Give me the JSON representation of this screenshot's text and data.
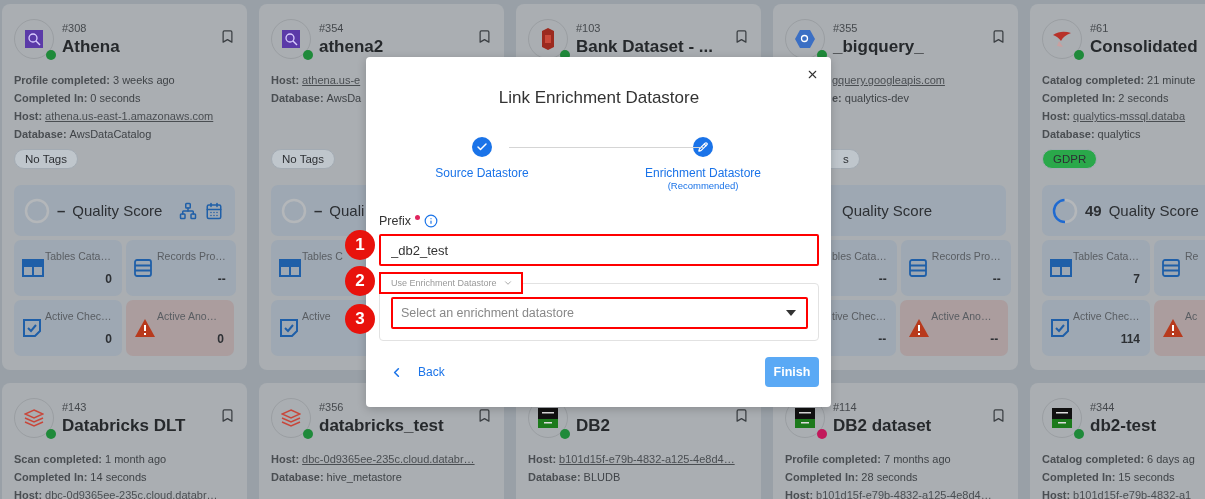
{
  "top_row": [
    {
      "number": "#308",
      "name": "Athena",
      "logo": {
        "kind": "athena"
      },
      "status": {
        "color": "#1f8a3a"
      },
      "details": [
        {
          "label": "Profile completed:",
          "value": "3 weeks ago"
        },
        {
          "label": "Completed In:",
          "value": "0 seconds"
        },
        {
          "label": "Host:",
          "value": "athena.us-east-1.amazonaws.com",
          "link": true
        },
        {
          "label": "Database:",
          "value": "AwsDataCatalog"
        }
      ],
      "tags": [
        {
          "label": "No Tags",
          "color": "#bfc6cc"
        }
      ],
      "quality": {
        "score": "–",
        "label": "Quality Score",
        "tools": true
      },
      "metrics": [
        [
          {
            "kind": "tables",
            "label": "Tables Cata…",
            "value": "0"
          },
          {
            "kind": "records",
            "label": "Records Pro…",
            "value": "--"
          }
        ],
        [
          {
            "kind": "checks",
            "label": "Active Chec…",
            "value": "0"
          },
          {
            "kind": "anomalies",
            "label": "Active Ano…",
            "value": "0"
          }
        ]
      ]
    },
    {
      "number": "#354",
      "name": "athena2",
      "logo": {
        "kind": "athena"
      },
      "status": {
        "color": "#1f8a3a"
      },
      "details": [
        {
          "label": "Host:",
          "value": "athena.us-e",
          "link": true
        },
        {
          "label": "Database:",
          "value": "AwsDa"
        }
      ],
      "tags": [
        {
          "label": "No Tags",
          "color": "#bfc6cc"
        }
      ],
      "quality": {
        "score": "–",
        "label": "Quali"
      },
      "metrics": [
        [
          {
            "kind": "tables",
            "label": "Tables C"
          }
        ],
        [
          {
            "kind": "checks",
            "label": "Active"
          }
        ]
      ]
    },
    {
      "number": "#103",
      "name": "Bank Dataset - ...",
      "logo": {
        "kind": "bank"
      },
      "status": {
        "color": "#1f8a3a"
      }
    },
    {
      "number": "#355",
      "name": "_bigquery_",
      "logo": {
        "kind": "bigquery"
      },
      "status": {
        "color": "#1f8a3a"
      },
      "details": [
        {
          "value": "gquery.googleapis.com",
          "link": true
        },
        {
          "label": "e:",
          "value": "qualytics-dev"
        }
      ],
      "tags": [
        {
          "label": "s",
          "color": "#bfc6cc"
        }
      ],
      "quality": {
        "label": "Quality Score"
      },
      "metrics": [
        [
          {
            "kind": "tables",
            "label": "bles Cata…",
            "value": "--",
            "cut": true
          },
          {
            "kind": "records",
            "label": "Records Pro…",
            "value": "--"
          }
        ],
        [
          {
            "kind": "checks",
            "label": "tive Chec…",
            "value": "--",
            "cut": true
          },
          {
            "kind": "anomalies",
            "label": "Active Ano…",
            "value": "--"
          }
        ]
      ]
    },
    {
      "number": "#61",
      "name": "Consolidated",
      "logo": {
        "kind": "mssql"
      },
      "status": {
        "color": "#1f8a3a"
      },
      "details": [
        {
          "label": "Catalog completed:",
          "value": "21 minute"
        },
        {
          "label": "Completed In:",
          "value": "2 seconds"
        },
        {
          "label": "Host:",
          "value": "qualytics-mssql.databa",
          "link": true
        },
        {
          "label": "Database:",
          "value": "qualytics"
        }
      ],
      "tags": [
        {
          "label": "GDPR",
          "color": "#2aa84a"
        }
      ],
      "quality": {
        "score": "49",
        "label": "Quality Score",
        "level": 0.49
      },
      "metrics": [
        [
          {
            "kind": "tables",
            "label": "Tables Cata…",
            "value": "7"
          },
          {
            "kind": "records",
            "label": "Re"
          }
        ],
        [
          {
            "kind": "checks",
            "label": "Active Chec…",
            "value": "114"
          },
          {
            "kind": "anomalies",
            "label": "Ac"
          }
        ]
      ]
    }
  ],
  "bottom_row": [
    {
      "number": "#143",
      "name": "Databricks DLT",
      "logo": {
        "kind": "databricks"
      },
      "status": {
        "color": "#1f8a3a"
      },
      "details": [
        {
          "label": "Scan completed:",
          "value": "1 month ago"
        },
        {
          "label": "Completed In:",
          "value": "14 seconds"
        },
        {
          "label": "Host:",
          "value": "dbc-0d9365ee-235c.cloud.databr…",
          "link": true
        }
      ]
    },
    {
      "number": "#356",
      "name": "databricks_test",
      "logo": {
        "kind": "databricks"
      },
      "status": {
        "color": "#1f8a3a"
      },
      "details": [
        {
          "label": "Host:",
          "value": "dbc-0d9365ee-235c.cloud.databr…",
          "link": true
        },
        {
          "label": "Database:",
          "value": "hive_metastore"
        }
      ]
    },
    {
      "name": "DB2",
      "logo": {
        "kind": "db2"
      },
      "status": {
        "color": "#1f8a3a"
      },
      "details": [
        {
          "label": "Host:",
          "value": "b101d15f-e79b-4832-a125-4e8d4…",
          "link": true
        },
        {
          "label": "Database:",
          "value": "BLUDB"
        }
      ]
    },
    {
      "number": "#114",
      "name": "DB2 dataset",
      "logo": {
        "kind": "db2"
      },
      "status": {
        "color": "#c2185b"
      },
      "details": [
        {
          "label": "Profile completed:",
          "value": "7 months ago"
        },
        {
          "label": "Completed In:",
          "value": "28 seconds"
        },
        {
          "label": "Host:",
          "value": "b101d15f-e79b-4832-a125-4e8d4…",
          "link": true
        }
      ]
    },
    {
      "number": "#344",
      "name": "db2-test",
      "logo": {
        "kind": "db2"
      },
      "status": {
        "color": "#1f8a3a"
      },
      "details": [
        {
          "label": "Catalog completed:",
          "value": "6 days ag"
        },
        {
          "label": "Completed In:",
          "value": "15 seconds"
        },
        {
          "label": "Host:",
          "value": "b101d15f-e79b-4832-a1",
          "link": true
        }
      ]
    }
  ],
  "dialog": {
    "title": "Link Enrichment Datastore",
    "steps": [
      {
        "label": "Source Datastore",
        "kind": "done"
      },
      {
        "label": "Enrichment Datastore",
        "sublabel": "(Recommended)",
        "kind": "active"
      }
    ],
    "prefix": {
      "label": "Prefix",
      "required": true,
      "value": "_db2_test",
      "highlighted": true
    },
    "enrichment": {
      "legend": "Use Enrichment Datastore",
      "legend_highlighted": true,
      "placeholder": "Select an enrichment datastore",
      "select_highlighted": true
    },
    "back": "Back",
    "finish": {
      "label": "Finish",
      "disabled": true
    }
  },
  "annotations": [
    {
      "number": "1"
    },
    {
      "number": "2"
    },
    {
      "number": "3"
    }
  ]
}
